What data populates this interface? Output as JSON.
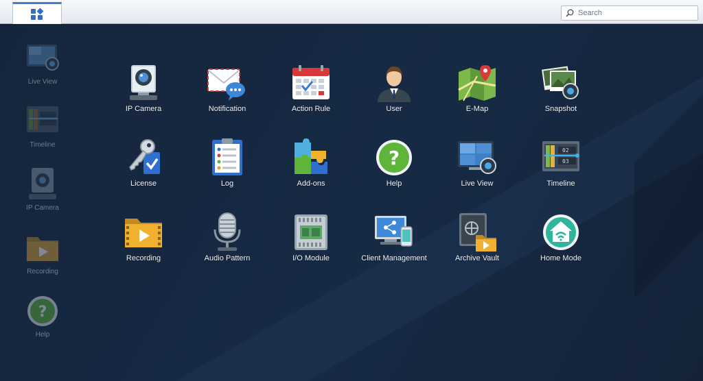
{
  "topbar": {
    "main_menu_icon": "grid-icon",
    "search": {
      "placeholder": "Search",
      "value": "",
      "icon": "search-icon"
    }
  },
  "shortcuts": [
    {
      "label": "Live View",
      "icon": "live-view-icon"
    },
    {
      "label": "Timeline",
      "icon": "timeline-icon"
    },
    {
      "label": "IP Camera",
      "icon": "ip-camera-icon"
    },
    {
      "label": "Recording",
      "icon": "recording-icon"
    },
    {
      "label": "Help",
      "icon": "help-icon"
    }
  ],
  "apps": [
    {
      "label": "IP Camera",
      "icon": "ip-camera-icon"
    },
    {
      "label": "Notification",
      "icon": "notification-icon"
    },
    {
      "label": "Action Rule",
      "icon": "action-rule-icon"
    },
    {
      "label": "User",
      "icon": "user-icon"
    },
    {
      "label": "E-Map",
      "icon": "e-map-icon"
    },
    {
      "label": "Snapshot",
      "icon": "snapshot-icon"
    },
    {
      "label": "License",
      "icon": "license-icon"
    },
    {
      "label": "Log",
      "icon": "log-icon"
    },
    {
      "label": "Add-ons",
      "icon": "add-ons-icon"
    },
    {
      "label": "Help",
      "icon": "help-icon"
    },
    {
      "label": "Live View",
      "icon": "live-view-icon"
    },
    {
      "label": "Timeline",
      "icon": "timeline-icon"
    },
    {
      "label": "Recording",
      "icon": "recording-icon"
    },
    {
      "label": "Audio Pattern",
      "icon": "audio-pattern-icon"
    },
    {
      "label": "I/O Module",
      "icon": "io-module-icon"
    },
    {
      "label": "Client Management",
      "icon": "client-management-icon"
    },
    {
      "label": "Archive Vault",
      "icon": "archive-vault-icon"
    },
    {
      "label": "Home Mode",
      "icon": "home-mode-icon"
    }
  ],
  "timeline_labels": [
    "02",
    "03"
  ]
}
